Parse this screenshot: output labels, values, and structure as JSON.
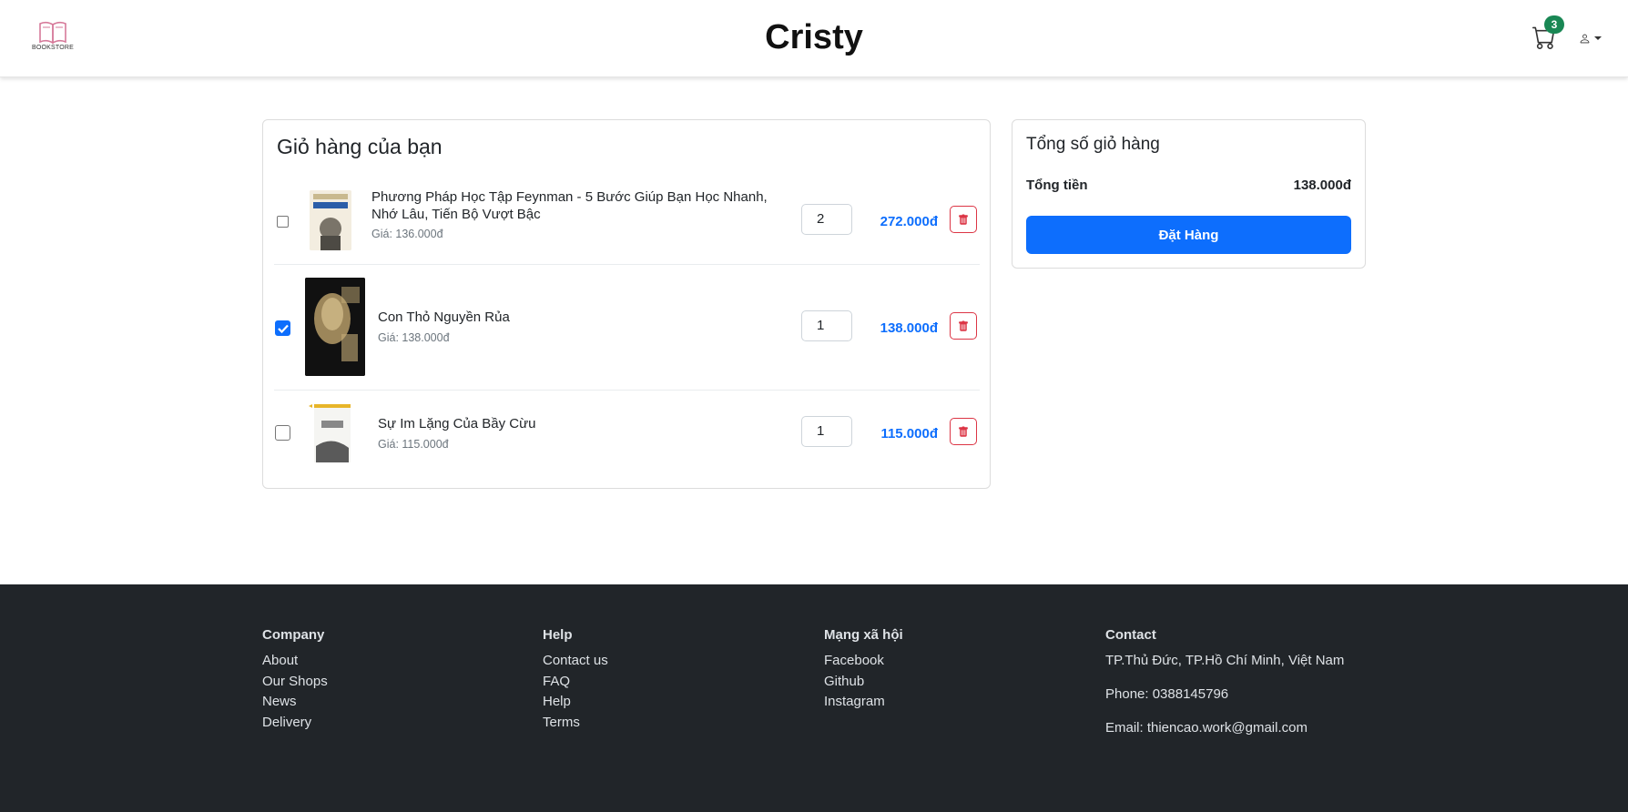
{
  "header": {
    "logo_text": "BOOKSTORE",
    "brand": "Cristy",
    "cart_count": "3",
    "cart_icon": "cart-icon",
    "user_icon": "user-icon"
  },
  "cart": {
    "title": "Giỏ hàng của bạn",
    "items": [
      {
        "name": "Phương Pháp Học Tập Feynman - 5 Bước Giúp Bạn Học Nhanh, Nhớ Lâu, Tiến Bộ Vượt Bậc",
        "price": "Giá: 136.000đ",
        "quantity": "2",
        "total": "272.000đ",
        "checked": false
      },
      {
        "name": "Con Thỏ Nguyền Rủa",
        "price": "Giá: 138.000đ",
        "quantity": "1",
        "total": "138.000đ",
        "checked": true
      },
      {
        "name": "Sự Im Lặng Của Bầy Cừu",
        "price": "Giá: 115.000đ",
        "quantity": "1",
        "total": "115.000đ",
        "checked": false
      }
    ]
  },
  "summary": {
    "title": "Tổng số giỏ hàng",
    "total_label": "Tổng tiền",
    "total_value": "138.000đ",
    "order_button": "Đặt Hàng"
  },
  "footer": {
    "company": {
      "heading": "Company",
      "links": [
        "About",
        "Our Shops",
        "News",
        "Delivery"
      ]
    },
    "help": {
      "heading": "Help",
      "links": [
        "Contact us",
        "FAQ",
        "Help",
        "Terms"
      ]
    },
    "social": {
      "heading": "Mạng xã hội",
      "links": [
        "Facebook",
        "Github",
        "Instagram"
      ]
    },
    "contact": {
      "heading": "Contact",
      "address": "TP.Thủ Đức, TP.Hồ Chí Minh, Việt Nam",
      "phone": "Phone: 0388145796",
      "email": "Email: thiencao.work@gmail.com"
    }
  },
  "colors": {
    "primary": "#0d6efd",
    "danger": "#dc3545",
    "badge": "#198754",
    "footer_bg": "#212529"
  }
}
